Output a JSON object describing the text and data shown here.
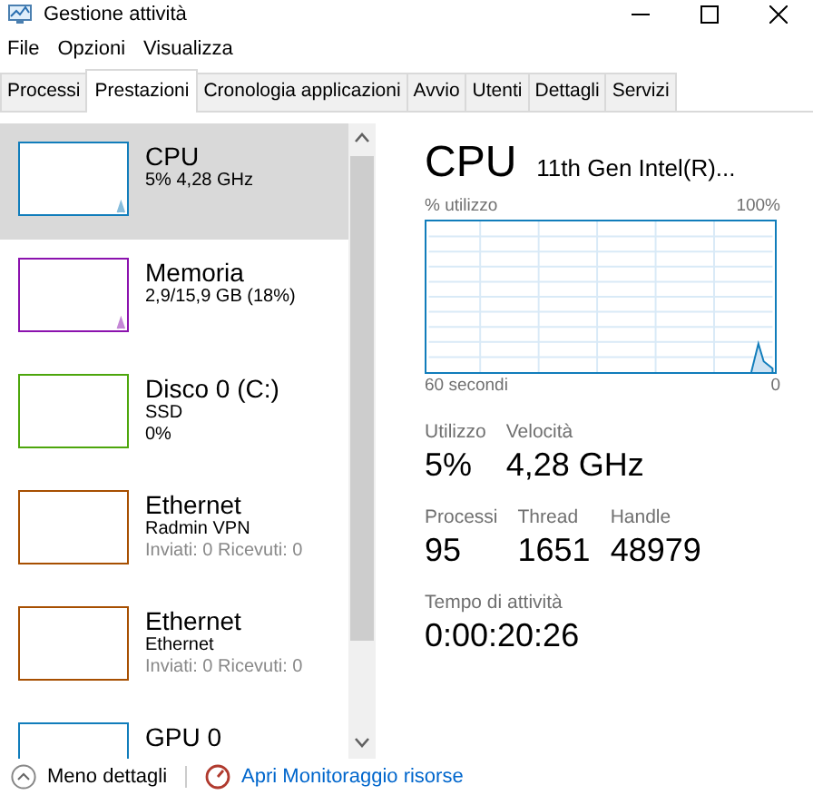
{
  "window": {
    "title": "Gestione attività"
  },
  "menu": [
    "File",
    "Opzioni",
    "Visualizza"
  ],
  "tabs": [
    {
      "label": "Processi",
      "selected": false
    },
    {
      "label": "Prestazioni",
      "selected": true
    },
    {
      "label": "Cronologia applicazioni",
      "selected": false
    },
    {
      "label": "Avvio",
      "selected": false
    },
    {
      "label": "Utenti",
      "selected": false
    },
    {
      "label": "Dettagli",
      "selected": false
    },
    {
      "label": "Servizi",
      "selected": false
    }
  ],
  "sidebar": {
    "items": [
      {
        "title": "CPU",
        "lines": [
          "5% 4,28 GHz"
        ],
        "color": "#117dbb",
        "selected": true
      },
      {
        "title": "Memoria",
        "lines": [
          "2,9/15,9 GB (18%)"
        ],
        "color": "#8b12ae",
        "selected": false
      },
      {
        "title": "Disco 0 (C:)",
        "lines": [
          "SSD",
          "0%"
        ],
        "color": "#4da60c",
        "selected": false
      },
      {
        "title": "Ethernet",
        "lines": [
          "Radmin VPN"
        ],
        "note": "Inviati: 0 Ricevuti: 0",
        "color": "#a74f01",
        "selected": false
      },
      {
        "title": "Ethernet",
        "lines": [
          "Ethernet"
        ],
        "note": "Inviati: 0 Ricevuti: 0",
        "color": "#a74f01",
        "selected": false
      },
      {
        "title": "GPU 0",
        "color": "#117dbb",
        "selected": false
      }
    ]
  },
  "detail": {
    "title": "CPU",
    "model": "11th Gen Intel(R)...",
    "graph_label": "% utilizzo",
    "graph_max": "100%",
    "graph_span": "60 secondi",
    "graph_min": "0",
    "stats": [
      [
        {
          "label": "Utilizzo",
          "value": "5%"
        },
        {
          "label": "Velocità",
          "value": "4,28 GHz"
        }
      ],
      [
        {
          "label": "Processi",
          "value": "95"
        },
        {
          "label": "Thread",
          "value": "1651"
        },
        {
          "label": "Handle",
          "value": "48979"
        }
      ],
      [
        {
          "label": "Tempo di attività",
          "value": "0:00:20:26"
        }
      ]
    ]
  },
  "footer": {
    "less": "Meno dettagli",
    "monitor": "Apri Monitoraggio risorse"
  }
}
